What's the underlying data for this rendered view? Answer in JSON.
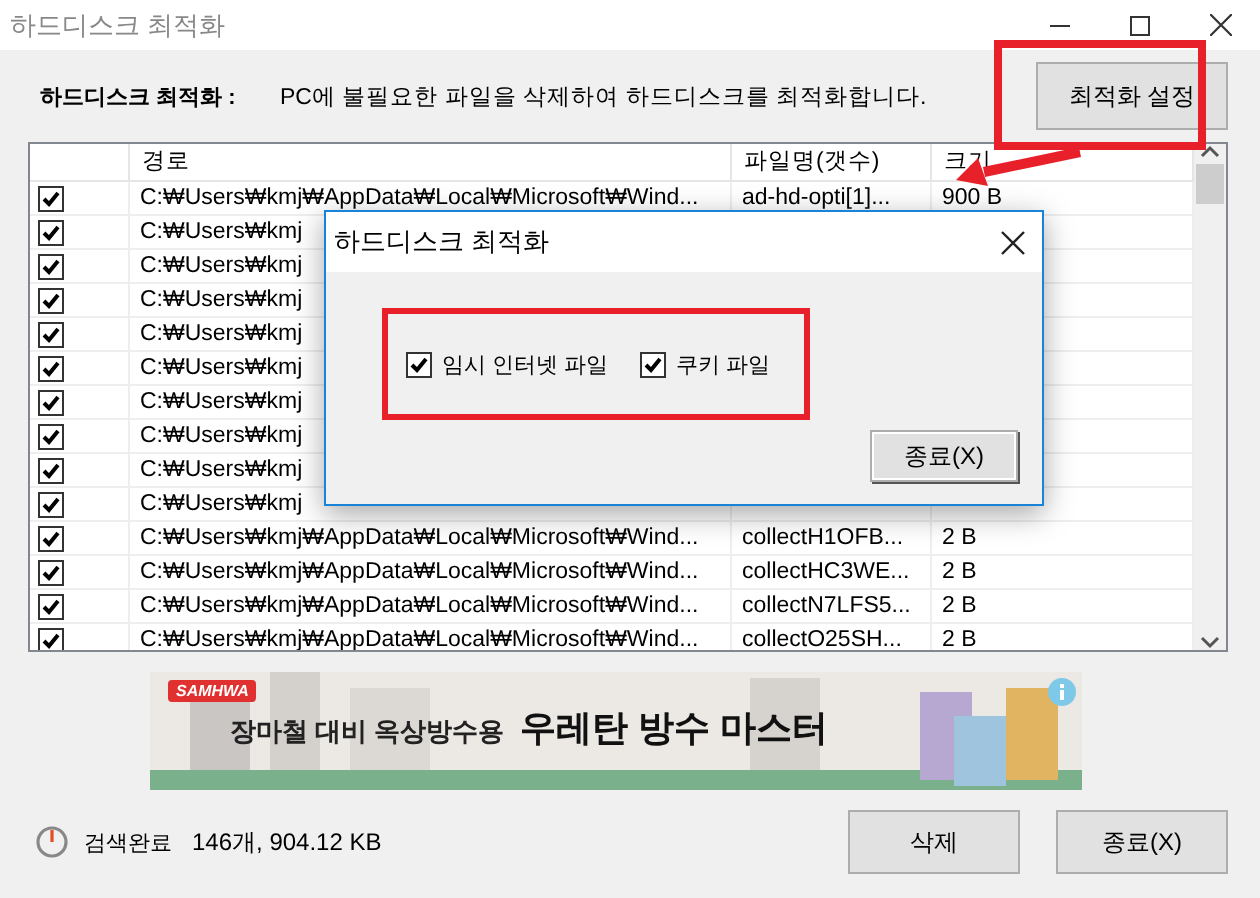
{
  "window": {
    "title": "하드디스크 최적화"
  },
  "header": {
    "label": "하드디스크 최적화 :",
    "description": "PC에 불필요한 파일을 삭제하여 하드디스크를 최적화합니다.",
    "settings_button": "최적화 설정"
  },
  "table": {
    "columns": [
      "경로",
      "파일명(갯수)",
      "크기"
    ],
    "rows": [
      {
        "checked": true,
        "path": "C:₩Users₩kmj₩AppData₩Local₩Microsoft₩Wind...",
        "file": "ad-hd-opti[1]...",
        "size": "900 B"
      },
      {
        "checked": true,
        "path": "C:₩Users₩kmj"
      },
      {
        "checked": true,
        "path": "C:₩Users₩kmj"
      },
      {
        "checked": true,
        "path": "C:₩Users₩kmj"
      },
      {
        "checked": true,
        "path": "C:₩Users₩kmj"
      },
      {
        "checked": true,
        "path": "C:₩Users₩kmj"
      },
      {
        "checked": true,
        "path": "C:₩Users₩kmj"
      },
      {
        "checked": true,
        "path": "C:₩Users₩kmj"
      },
      {
        "checked": true,
        "path": "C:₩Users₩kmj"
      },
      {
        "checked": true,
        "path": "C:₩Users₩kmj"
      },
      {
        "checked": true,
        "path": "C:₩Users₩kmj₩AppData₩Local₩Microsoft₩Wind...",
        "file": "collectH1OFB...",
        "size": "2 B"
      },
      {
        "checked": true,
        "path": "C:₩Users₩kmj₩AppData₩Local₩Microsoft₩Wind...",
        "file": "collectHC3WE...",
        "size": "2 B"
      },
      {
        "checked": true,
        "path": "C:₩Users₩kmj₩AppData₩Local₩Microsoft₩Wind...",
        "file": "collectN7LFS5...",
        "size": "2 B"
      },
      {
        "checked": true,
        "path": "C:₩Users₩kmj₩AppData₩Local₩Microsoft₩Wind...",
        "file": "collectO25SH...",
        "size": "2 B"
      }
    ]
  },
  "ad": {
    "kind": "picture",
    "brand": "SAMHWA",
    "headline_1": "장마철 대비 옥상방수용",
    "headline_2": "우레탄 방수 마스터"
  },
  "status": {
    "label": "검색완료",
    "summary": "146개, 904.12 KB"
  },
  "buttons": [
    "삭제",
    "종료(X)"
  ],
  "dialog": {
    "title": "하드디스크 최적화",
    "options": [
      {
        "label": "임시 인터넷 파일",
        "checked": true
      },
      {
        "label": "쿠키 파일",
        "checked": true
      }
    ],
    "close_button": "종료(X)"
  }
}
